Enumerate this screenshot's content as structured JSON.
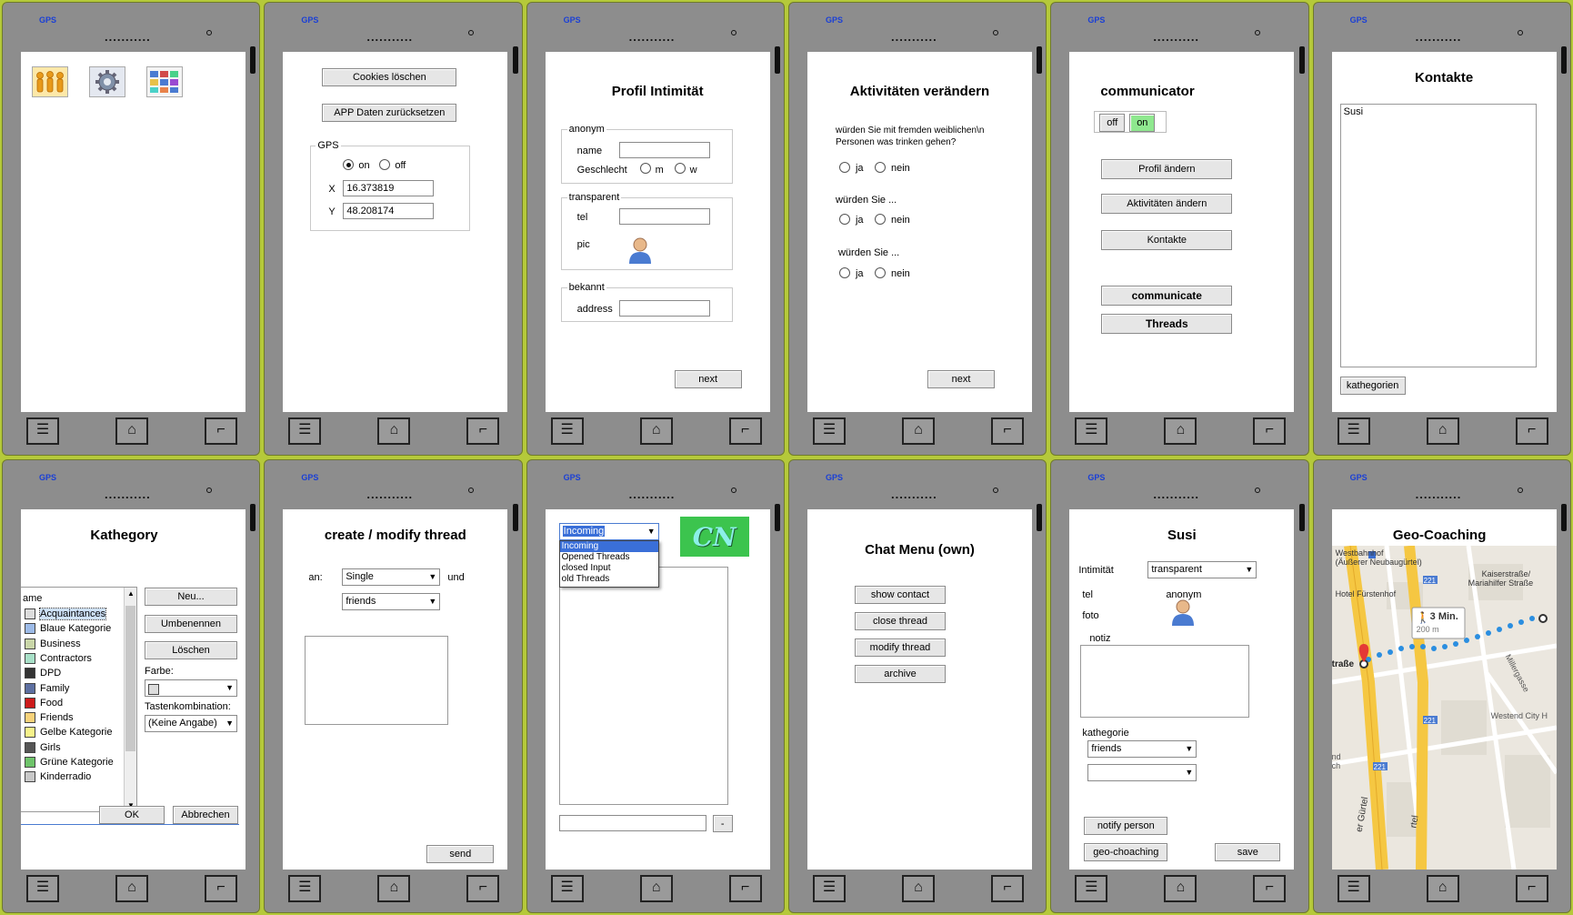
{
  "common": {
    "gps": "GPS",
    "dots": "...........",
    "menu_icon": "menu-icon",
    "home_icon": "home-icon",
    "back_icon": "back-icon"
  },
  "s1": {
    "icons": [
      "people-icon",
      "gear-icon",
      "grid-icon"
    ]
  },
  "s2": {
    "cookies": "Cookies löschen",
    "app_reset": "APP Daten zurücksetzen",
    "gps_group": "GPS",
    "on": "on",
    "off": "off",
    "x_label": "X",
    "x_value": "16.373819",
    "y_label": "Y",
    "y_value": "48.208174"
  },
  "s3": {
    "title": "Profil Intimität",
    "anonym": "anonym",
    "name": "name",
    "geschlecht": "Geschlecht",
    "m": "m",
    "w": "w",
    "transparent": "transparent",
    "tel": "tel",
    "pic": "pic",
    "bekannt": "bekannt",
    "address": "address",
    "next": "next"
  },
  "s4": {
    "title": "Aktivitäten verändern",
    "q1": "würden Sie mit fremden weiblichen\\n Personen was trinken gehen?",
    "q2": "würden Sie ...",
    "q3": "würden Sie ...",
    "ja": "ja",
    "nein": "nein",
    "next": "next"
  },
  "s5": {
    "title": "communicator",
    "off": "off",
    "on": "on",
    "profil": "Profil ändern",
    "aktiv": "Aktivitäten ändern",
    "kontakte": "Kontakte",
    "communicate": "communicate",
    "threads": "Threads"
  },
  "s6": {
    "title": "Kontakte",
    "contact": "Susi",
    "kathegorien": "kathegorien"
  },
  "s7": {
    "title": "Kathegory",
    "header": "ame",
    "items": [
      {
        "label": "Acquaintances",
        "color": "#dcdcdc"
      },
      {
        "label": "Blaue Kategorie",
        "color": "#9dbbe8"
      },
      {
        "label": "Business",
        "color": "#c9d6a8"
      },
      {
        "label": "Contractors",
        "color": "#a8e0c8"
      },
      {
        "label": "DPD",
        "color": "#333333"
      },
      {
        "label": "Family",
        "color": "#5d6fa0"
      },
      {
        "label": "Food",
        "color": "#cc1b1b"
      },
      {
        "label": "Friends",
        "color": "#f7d27a"
      },
      {
        "label": "Gelbe Kategorie",
        "color": "#f7f28a"
      },
      {
        "label": "Girls",
        "color": "#555555"
      },
      {
        "label": "Grüne Kategorie",
        "color": "#6ec36a"
      },
      {
        "label": "Kinderradio",
        "color": "#c8c8c8"
      }
    ],
    "neu": "Neu...",
    "umbenennen": "Umbenennen",
    "loeschen": "Löschen",
    "farbe": "Farbe:",
    "tasten": "Tastenkombination:",
    "keine": "(Keine Angabe)",
    "ok": "OK",
    "abbrechen": "Abbrechen"
  },
  "s8": {
    "title": "create / modify thread",
    "an": "an:",
    "single": "Single",
    "und": "und",
    "friends": "friends",
    "send": "send"
  },
  "s9": {
    "selected": "Incoming",
    "options": [
      "Incoming",
      "Opened Threads",
      "closed Input",
      "old Threads"
    ],
    "logo": "CN",
    "minus": "-"
  },
  "s10": {
    "title": "Chat Menu (own)",
    "show": "show contact",
    "close": "close thread",
    "modify": "modify thread",
    "archive": "archive"
  },
  "s11": {
    "title": "Susi",
    "intimitaet": "Intimität",
    "transparent": "transparent",
    "tel": "tel",
    "anonym": "anonym",
    "foto": "foto",
    "notiz": "notiz",
    "kathegorie": "kathegorie",
    "friends": "friends",
    "notify": "notify person",
    "geo": "geo-choaching",
    "save": "save"
  },
  "s12": {
    "title": "Geo-Coaching",
    "westbahnhof": "Westbahnhof",
    "aeusserer": "(Äußerer Neubaugürtel)",
    "hotel": "Hotel Fürstenhof",
    "kaiser": "Kaiserstraße/",
    "mariahilfer": "Mariahilfer Straße",
    "walk": "3 Min.",
    "dist": "200 m",
    "strasse": "traße",
    "westend": "Westend City H",
    "millergasse": "Millergasse",
    "guertel1": "er Gürtel",
    "guertel2": "rtel",
    "road221": "221",
    "nd": "nd",
    "ch": "ch"
  }
}
